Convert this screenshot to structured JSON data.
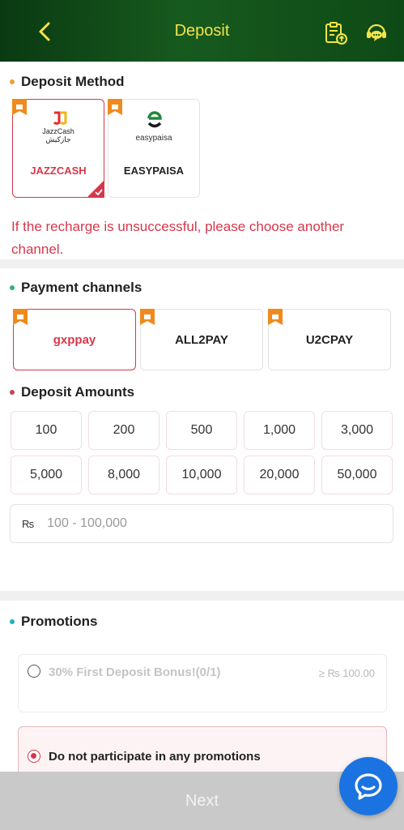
{
  "header": {
    "title": "Deposit",
    "back_icon": "chevron-left-icon",
    "history_icon": "clipboard-upload-icon",
    "support_icon": "chat-support-icon",
    "accent": "#f3e34a"
  },
  "deposit_method": {
    "title": "Deposit Method",
    "methods": [
      {
        "label": "JAZZCASH",
        "logo_text": "JazzCash",
        "logo_urdu": "جازکیش",
        "selected": true
      },
      {
        "label": "EASYPAISA",
        "logo_text": "easypaisa",
        "selected": false
      }
    ],
    "warning": "If the recharge is unsuccessful, please choose another channel."
  },
  "payment_channels": {
    "title": "Payment channels",
    "channels": [
      {
        "label": "gxppay",
        "selected": true
      },
      {
        "label": "ALL2PAY",
        "selected": false
      },
      {
        "label": "U2CPAY",
        "selected": false
      }
    ]
  },
  "deposit_amounts": {
    "title": "Deposit Amounts",
    "amounts": [
      "100",
      "200",
      "500",
      "1,000",
      "3,000",
      "5,000",
      "8,000",
      "10,000",
      "20,000",
      "50,000"
    ],
    "currency": "₨",
    "placeholder": "100 - 100,000"
  },
  "promotions": {
    "title": "Promotions",
    "items": [
      {
        "label": "30% First Deposit Bonus!(0/1)",
        "min": "≥ ₨ 100.00",
        "disabled": true
      },
      {
        "label": "Do not participate in any promotions",
        "selected": true
      }
    ]
  },
  "footer": {
    "next_label": "Next",
    "chat_icon": "chat-bubble-icon"
  },
  "colors": {
    "header_bg": "#175a1e",
    "primary_red": "#d6374b",
    "fab_blue": "#1a73e0"
  }
}
